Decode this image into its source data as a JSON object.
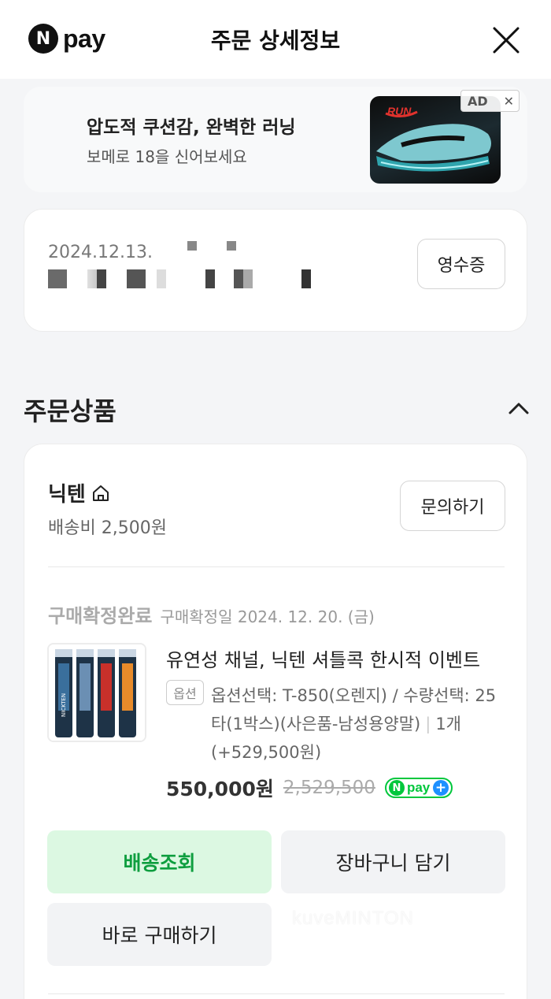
{
  "header": {
    "logo_letter": "N",
    "logo_text": "pay",
    "title": "주문 상세정보",
    "close_icon": "close-icon"
  },
  "ad": {
    "title": "압도적 쿠션감, 완벽한 러닝",
    "subtitle": "보메로 18을 신어보세요",
    "badge": "AD",
    "badge_close": "✕",
    "image_brand": "RUN"
  },
  "order": {
    "date": "2024.12.13.",
    "receipt_label": "영수증"
  },
  "section": {
    "title": "주문상품"
  },
  "seller": {
    "name": "닉텐",
    "shipping_fee": "배송비 2,500원",
    "inquiry_label": "문의하기"
  },
  "item": {
    "status": "구매확정완료",
    "status_date": "구매확정일 2024. 12. 20. (금)",
    "name": "유연성 채널, 닉텐 셔틀콕 한시적 이벤트",
    "option_tag": "옵션",
    "option_text": "옵션선택: T-850(오렌지) / 수량선택: 25타(1박스)(사은품-남성용양말)",
    "quantity": "1개",
    "option_extra": "(+529,500원)",
    "price": "550,000원",
    "original_price": "2,529,500",
    "npay_letter": "N",
    "npay_word": "pay",
    "npay_plus": "+",
    "tube_label": "NICKTEN"
  },
  "buttons": {
    "tracking": "배송조회",
    "cart": "장바구니 담기",
    "buy_now": "바로 구매하기"
  },
  "watermark": "kuveMINTON",
  "colors": {
    "accent_green": "#0e9e3f",
    "tracking_bg": "#dcf8e2",
    "npay_green": "#00c73c"
  }
}
